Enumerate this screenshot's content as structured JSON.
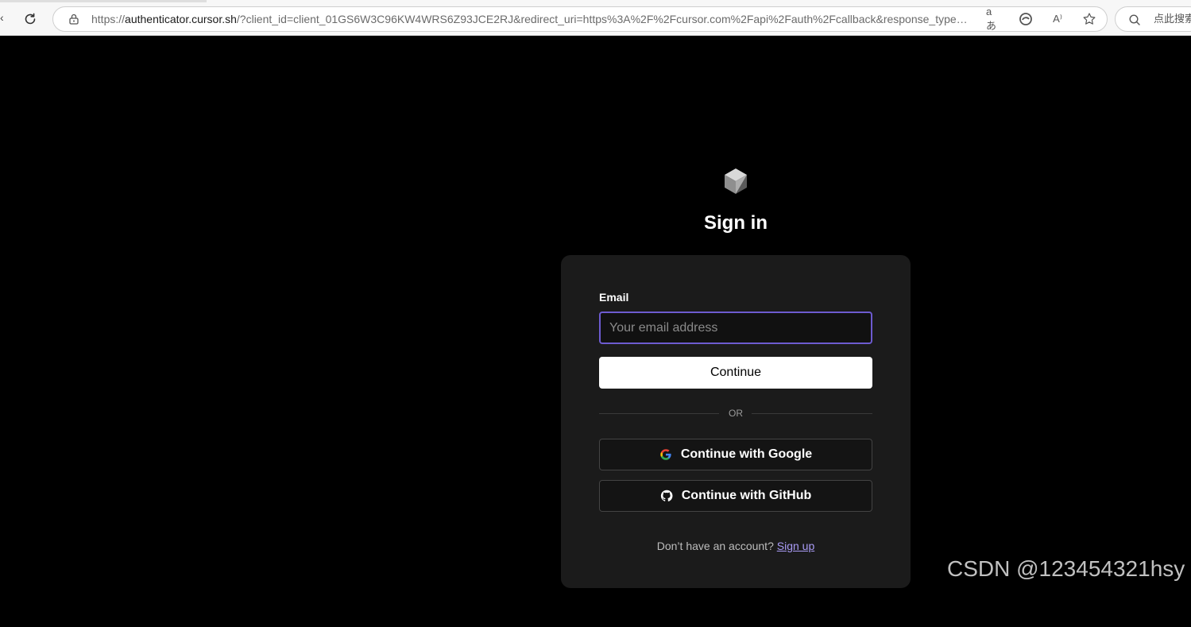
{
  "browser": {
    "url_scheme": "https://",
    "url_host": "authenticator.cursor.sh",
    "url_rest": "/?client_id=client_01GS6W3C96KW4WRS6Z93JCE2RJ&redirect_uri=https%3A%2F%2Fcursor.com%2Fapi%2Fauth%2Fcallback&response_type=code...",
    "translate_icon_text": "aあ",
    "read_aloud_icon_text": "A⁾",
    "search_placeholder": "点此搜索"
  },
  "page": {
    "title": "Sign in",
    "email": {
      "label": "Email",
      "placeholder": "Your email address",
      "value": ""
    },
    "continue_label": "Continue",
    "or_label": "OR",
    "google_label": "Continue with Google",
    "github_label": "Continue with GitHub",
    "signup_prompt": "Don’t have an account?",
    "signup_link": "Sign up"
  },
  "watermark": "CSDN @123454321hsy",
  "colors": {
    "background": "#000000",
    "card": "#1b1b1b",
    "accent_focus": "#6d5bd0",
    "link": "#a99bf5"
  }
}
